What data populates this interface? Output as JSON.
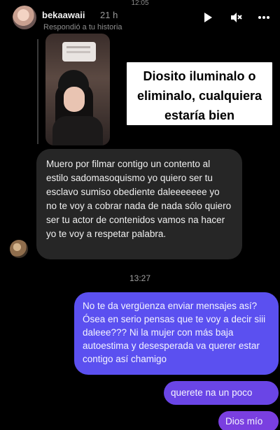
{
  "status": {
    "clock": "12:05"
  },
  "header": {
    "username": "bekaawaii",
    "time_ago": "21 h",
    "replied_text": "Respondió a tu historia",
    "icons": [
      "play-icon",
      "mute-icon",
      "more-icon"
    ]
  },
  "story": {
    "caption": "Diosito iluminalo o eliminalo, cualquiera estaría bien"
  },
  "messages": {
    "incoming": "Muero por filmar contigo un contento al estilo sadomasoquismo yo quiero ser tu esclavo sumiso obediente daleeeeeee yo no te voy a cobrar nada de nada sólo quiero ser tu actor de contenidos vamos na hacer yo te voy a respetar palabra.",
    "timestamp": "13:27",
    "outgoing_1": "No te da vergüenza enviar mensajes así? Ósea en serio pensas que te voy a decir siii daleee??? Ni la mujer con más baja autoestima y desesperada va querer estar contigo así chamigo",
    "outgoing_2": "querete na un poco",
    "outgoing_3": "Dios mío"
  },
  "colors": {
    "background": "#000000",
    "incoming_bubble": "#262626",
    "outgoing_bubble": "#5b50f0"
  }
}
